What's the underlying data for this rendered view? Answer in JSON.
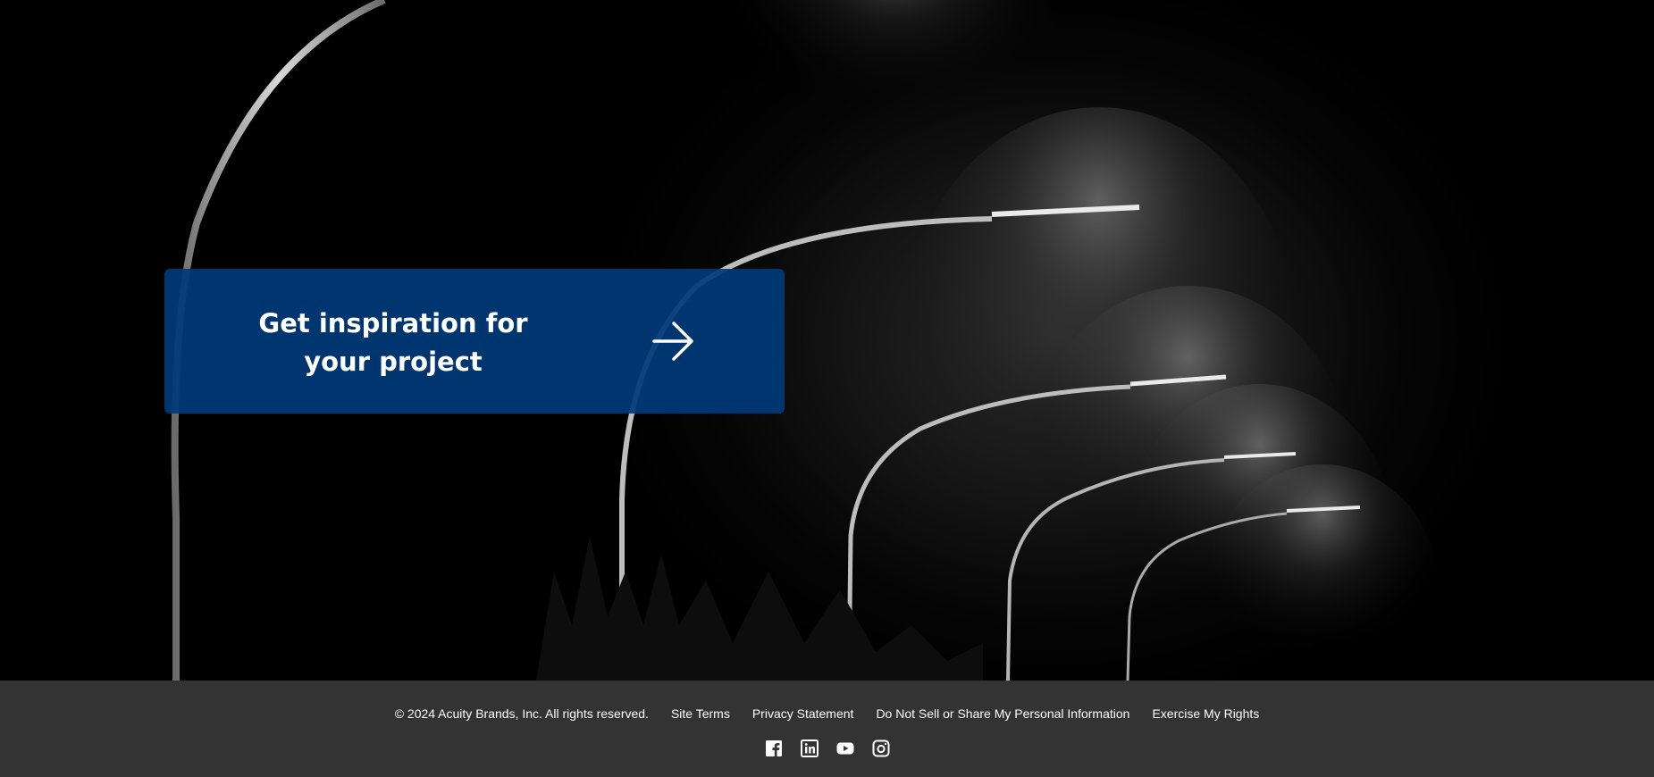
{
  "hero": {
    "cta_label": "Get inspiration for your project",
    "cta_line1": "Get inspiration for",
    "cta_line2": "your project",
    "cta_icon": "arrow-right-icon",
    "cta_color": "#003A78"
  },
  "footer": {
    "background": "#333333",
    "copyright": "© 2024 Acuity Brands, Inc. All rights reserved.",
    "links": [
      {
        "label": "Site Terms"
      },
      {
        "label": "Privacy Statement"
      },
      {
        "label": "Do Not Sell or Share My Personal Information"
      },
      {
        "label": "Exercise My Rights"
      }
    ],
    "social": [
      {
        "icon": "facebook-icon"
      },
      {
        "icon": "linkedin-icon"
      },
      {
        "icon": "youtube-icon"
      },
      {
        "icon": "instagram-icon"
      }
    ]
  }
}
